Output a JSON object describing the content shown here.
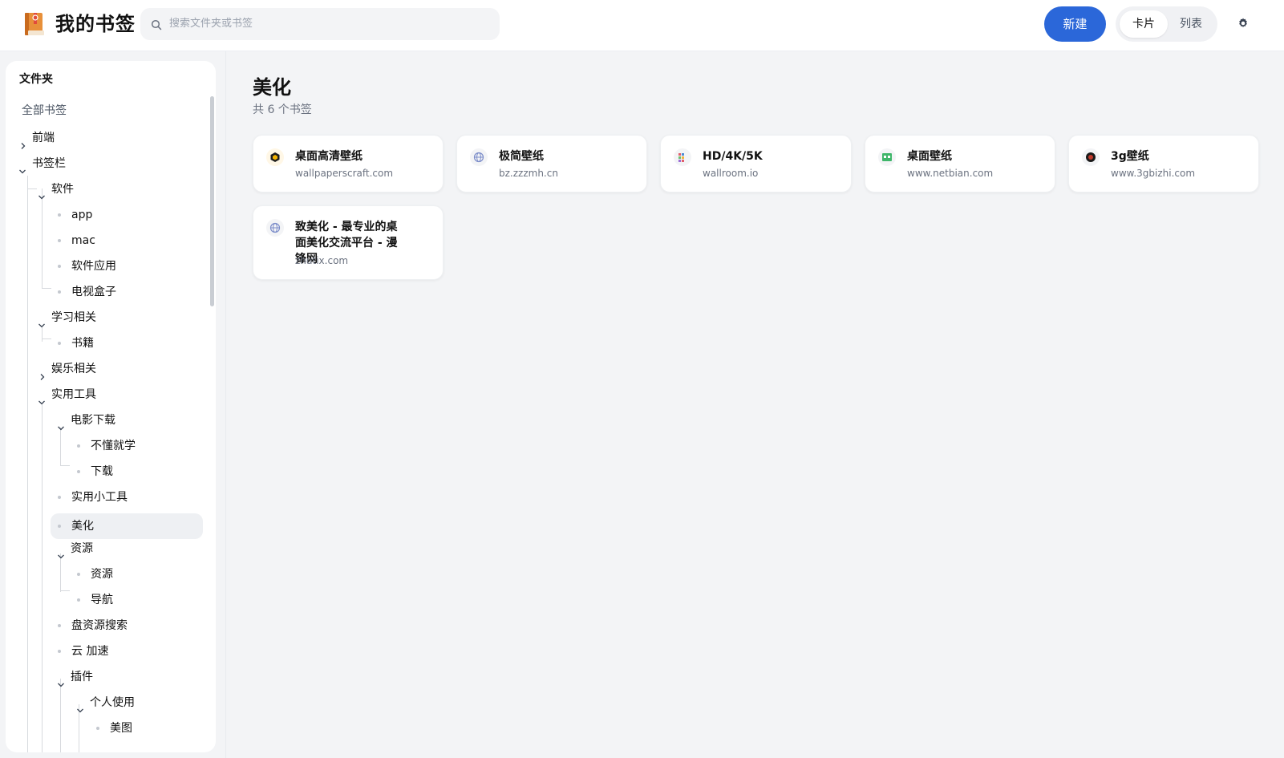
{
  "header": {
    "title": "我的书签",
    "search_placeholder": "搜索文件夹或书签",
    "new_button": "新建",
    "view_card": "卡片",
    "view_list": "列表"
  },
  "sidebar": {
    "title": "文件夹",
    "all_bookmarks": "全部书签",
    "tree": [
      {
        "label": "前端",
        "type": "collapsed"
      },
      {
        "label": "书签栏",
        "type": "expanded"
      },
      {
        "label": "软件",
        "type": "expanded"
      },
      {
        "label": "app",
        "type": "leaf"
      },
      {
        "label": "mac",
        "type": "leaf"
      },
      {
        "label": "软件应用",
        "type": "leaf"
      },
      {
        "label": "电视盒子",
        "type": "leaf"
      },
      {
        "label": "学习相关",
        "type": "expanded"
      },
      {
        "label": "书籍",
        "type": "leaf"
      },
      {
        "label": "娱乐相关",
        "type": "collapsed"
      },
      {
        "label": "实用工具",
        "type": "expanded"
      },
      {
        "label": "电影下载",
        "type": "expanded"
      },
      {
        "label": "不懂就学",
        "type": "leaf"
      },
      {
        "label": "下载",
        "type": "leaf"
      },
      {
        "label": "实用小工具",
        "type": "leaf"
      },
      {
        "label": "美化",
        "type": "leaf",
        "active": true
      },
      {
        "label": "资源",
        "type": "expanded"
      },
      {
        "label": "资源",
        "type": "leaf"
      },
      {
        "label": "导航",
        "type": "leaf"
      },
      {
        "label": "盘资源搜索",
        "type": "leaf"
      },
      {
        "label": "云 加速",
        "type": "leaf"
      },
      {
        "label": "插件",
        "type": "expanded"
      },
      {
        "label": "个人使用",
        "type": "expanded"
      },
      {
        "label": "美图",
        "type": "leaf"
      }
    ]
  },
  "main": {
    "title": "美化",
    "count": "共 6 个书签",
    "bookmarks": [
      {
        "title": "桌面高清壁纸",
        "url": "wallpaperscraft.com",
        "icon": "wallpaperscraft-icon"
      },
      {
        "title": "极简壁纸",
        "url": "bz.zzzmh.cn",
        "icon": "globe-icon"
      },
      {
        "title": "HD/4K/5K",
        "url": "wallroom.io",
        "icon": "wallroom-icon"
      },
      {
        "title": "桌面壁纸",
        "url": "www.netbian.com",
        "icon": "netbian-icon"
      },
      {
        "title": "3g壁纸",
        "url": "www.3gbizhi.com",
        "icon": "3gbizhi-icon"
      },
      {
        "title": "致美化 - 最专业的桌面美化交流平台 - 漫锋网",
        "url": "zhutix.com",
        "icon": "globe-icon"
      }
    ]
  },
  "colors": {
    "accent": "#2b67d9",
    "background": "#f3f4f6"
  }
}
